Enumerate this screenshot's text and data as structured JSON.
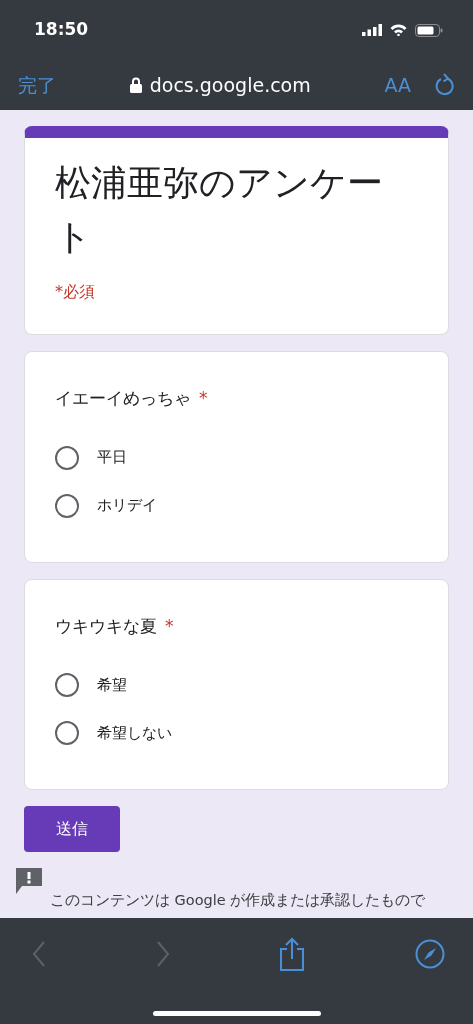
{
  "status_bar": {
    "time": "18:50"
  },
  "browser_bar": {
    "done": "完了",
    "url": "docs.google.com",
    "text_size": "AA"
  },
  "form": {
    "title": "松浦亜弥のアンケート",
    "required_note": "*必須",
    "questions": [
      {
        "title": "イエーイめっちゃ",
        "required_mark": "*",
        "options": [
          {
            "label": "平日",
            "selected": false
          },
          {
            "label": "ホリデイ",
            "selected": false
          }
        ]
      },
      {
        "title": "ウキウキな夏",
        "required_mark": "*",
        "options": [
          {
            "label": "希望",
            "selected": false
          },
          {
            "label": "希望しない",
            "selected": false
          }
        ]
      }
    ],
    "submit": "送信",
    "notice": "このコンテンツは Google が作成または承認したもので"
  },
  "toolbar": [
    {
      "kind": "back",
      "disabled": true
    },
    {
      "kind": "forward",
      "disabled": true
    },
    {
      "kind": "share",
      "disabled": false
    },
    {
      "kind": "compass",
      "disabled": false
    }
  ]
}
